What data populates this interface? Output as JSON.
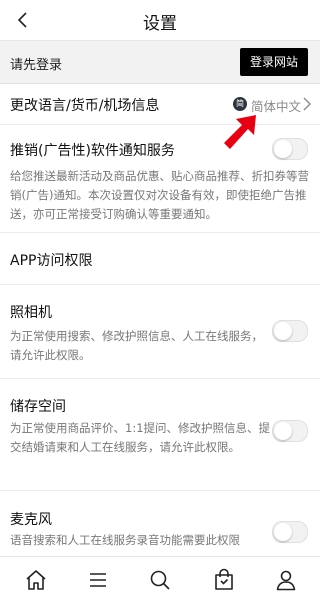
{
  "header": {
    "title": "设置"
  },
  "login": {
    "prompt": "请先登录",
    "button": "登录网站"
  },
  "language": {
    "label": "更改语言/货币/机场信息",
    "badge": "简",
    "value": "简体中文"
  },
  "ads": {
    "title": "推销(广告性)软件通知服务",
    "description": "给您推送最新活动及商品优惠、贴心商品推荐、折扣券等营销(广告)通知。本次设置仅对次设备有效，即使拒绝广告推送，亦可正常接受订购确认等重要通知。",
    "enabled": false
  },
  "permissions": {
    "section_title": "APP访问权限",
    "camera": {
      "title": "照相机",
      "description": "为正常使用搜索、修改护照信息、人工在线服务，请允许此权限。",
      "enabled": false
    },
    "storage": {
      "title": "储存空间",
      "description": "为正常使用商品评价、1:1提问、修改护照信息、提交结婚请柬和人工在线服务，请允许此权限。",
      "enabled": false
    },
    "microphone": {
      "title": "麦克风",
      "description": "语音搜索和人工在线服务录音功能需要此权限",
      "enabled": false
    }
  },
  "nav": {
    "items": [
      "home-icon",
      "menu-icon",
      "search-icon",
      "shopping-bag-icon",
      "user-icon"
    ]
  }
}
